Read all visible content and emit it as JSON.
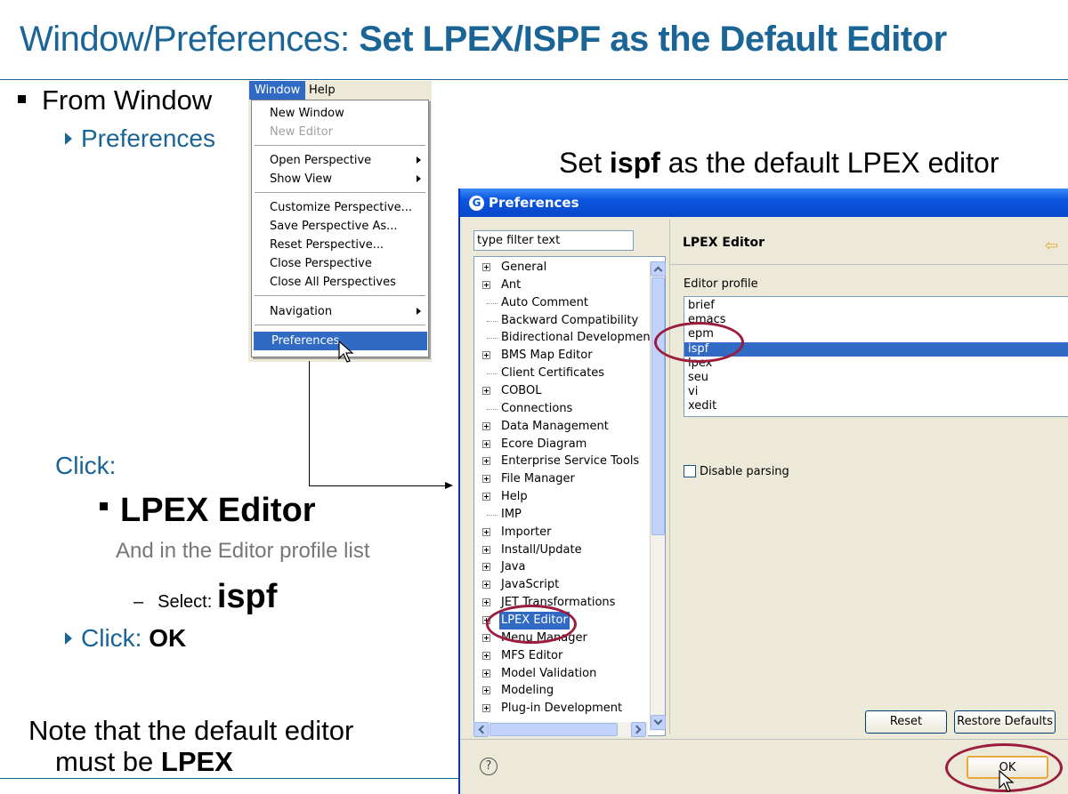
{
  "slide": {
    "title_prefix": "Window/Preferences: ",
    "title_bold": "Set LPEX/ISPF as the Default Editor",
    "bullet_from_window": "From Window",
    "bullet_preferences": "Preferences",
    "click_label": "Click:",
    "lpex_editor": "LPEX Editor",
    "and_list": "And in the Editor profile list",
    "select_dash": "–",
    "select_label": "Select: ",
    "select_value": "ispf",
    "click_ok_prefix": "Click: ",
    "click_ok_bold": "OK",
    "note_line1": "Note that the default editor",
    "note_line2_prefix": "must be ",
    "note_line2_bold": "LPEX",
    "caption_prefix": "Set ",
    "caption_bold": "ispf",
    "caption_suffix": " as the default LPEX editor"
  },
  "window_menu": {
    "menubar": [
      "Window",
      "Help"
    ],
    "items": [
      {
        "label": "New Window",
        "disabled": false
      },
      {
        "label": "New Editor",
        "disabled": true
      },
      {
        "label": "Open Perspective",
        "submenu": true
      },
      {
        "label": "Show View",
        "submenu": true
      },
      {
        "label": "Customize Perspective..."
      },
      {
        "label": "Save Perspective As..."
      },
      {
        "label": "Reset Perspective..."
      },
      {
        "label": "Close Perspective"
      },
      {
        "label": "Close All Perspectives"
      },
      {
        "label": "Navigation",
        "submenu": true
      },
      {
        "label": "Preferences",
        "selected": true
      }
    ]
  },
  "preferences_dialog": {
    "title": "Preferences",
    "filter_placeholder": "type filter text",
    "tree_items": [
      {
        "label": "General",
        "expandable": true
      },
      {
        "label": "Ant",
        "expandable": true
      },
      {
        "label": "Auto Comment",
        "expandable": false
      },
      {
        "label": "Backward Compatibility",
        "expandable": false
      },
      {
        "label": "Bidirectional Development",
        "expandable": false
      },
      {
        "label": "BMS Map Editor",
        "expandable": true
      },
      {
        "label": "Client Certificates",
        "expandable": false
      },
      {
        "label": "COBOL",
        "expandable": true
      },
      {
        "label": "Connections",
        "expandable": false
      },
      {
        "label": "Data Management",
        "expandable": true
      },
      {
        "label": "Ecore Diagram",
        "expandable": true
      },
      {
        "label": "Enterprise Service Tools",
        "expandable": true
      },
      {
        "label": "File Manager",
        "expandable": true
      },
      {
        "label": "Help",
        "expandable": true
      },
      {
        "label": "IMP",
        "expandable": false
      },
      {
        "label": "Importer",
        "expandable": true
      },
      {
        "label": "Install/Update",
        "expandable": true
      },
      {
        "label": "Java",
        "expandable": true
      },
      {
        "label": "JavaScript",
        "expandable": true
      },
      {
        "label": "JET Transformations",
        "expandable": true
      },
      {
        "label": "LPEX Editor",
        "expandable": true,
        "selected": true
      },
      {
        "label": "Menu Manager",
        "expandable": true
      },
      {
        "label": "MFS Editor",
        "expandable": true
      },
      {
        "label": "Model Validation",
        "expandable": true
      },
      {
        "label": "Modeling",
        "expandable": true
      },
      {
        "label": "Plug-in Development",
        "expandable": true
      }
    ],
    "page_title": "LPEX Editor",
    "profile_label": "Editor profile",
    "profiles": [
      "brief",
      "emacs",
      "epm",
      "ispf",
      "lpex",
      "seu",
      "vi",
      "xedit"
    ],
    "selected_profile": "ispf",
    "disable_parsing_label": "Disable parsing",
    "disable_parsing_checked": false,
    "reset_label": "Reset",
    "restore_defaults_label": "Restore Defaults",
    "ok_label": "OK",
    "help_glyph": "?"
  },
  "colors": {
    "title_blue": "#1a6496",
    "selection_blue": "#316ac5",
    "highlight_oval": "#9b1c3c"
  }
}
